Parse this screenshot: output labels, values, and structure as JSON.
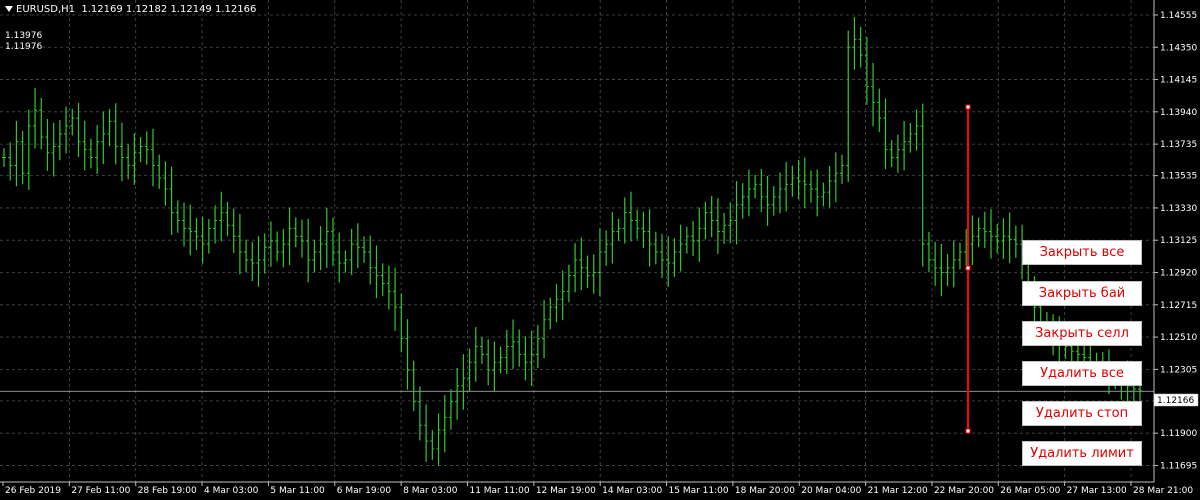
{
  "header": {
    "symbol_timeframe": "EURUSD,H1",
    "ohlc": "1.12169 1.12182 1.12149 1.12166"
  },
  "levels": [
    "1.13976",
    "1.11976"
  ],
  "buttons": [
    "Закрыть все",
    "Закрыть бай",
    "Закрыть селл",
    "Удалить все",
    "Удалить стоп",
    "Удалить лимит"
  ],
  "colors": {
    "background": "#000000",
    "grid": "#4d4d4d",
    "candles": "#32c832",
    "current_price_line": "#c0c0c0",
    "measure_line": "#ff0000",
    "button_text": "#e00000"
  },
  "chart_data": {
    "type": "line",
    "style": "hourly bars",
    "symbol": "EURUSD",
    "timeframe": "H1",
    "grid": true,
    "current_price": "1.12166",
    "ylim": [
      1.1159,
      1.1465
    ],
    "y_ticks": [
      "1.14555",
      "1.14350",
      "1.14145",
      "1.13940",
      "1.13735",
      "1.13535",
      "1.13330",
      "1.13125",
      "1.12920",
      "1.12715",
      "1.12510",
      "1.12305",
      "1.12105",
      "1.11900",
      "1.11695"
    ],
    "x_ticks": [
      "26 Feb 2019",
      "27 Feb 11:00",
      "28 Feb 19:00",
      "4 Mar 03:00",
      "5 Mar 11:00",
      "6 Mar 19:00",
      "8 Mar 03:00",
      "11 Mar 11:00",
      "12 Mar 19:00",
      "14 Mar 03:00",
      "15 Mar 11:00",
      "18 Mar 20:00",
      "20 Mar 04:00",
      "21 Mar 12:00",
      "22 Mar 20:00",
      "26 Mar 05:00",
      "27 Mar 13:00",
      "28 Mar 21:00"
    ],
    "series": [
      {
        "values": [
          1.1365,
          1.136,
          1.1375,
          1.1355,
          1.1385,
          1.1395,
          1.1378,
          1.1368,
          1.1372,
          1.138,
          1.1385,
          1.139,
          1.1375,
          1.137,
          1.1365,
          1.1375,
          1.138,
          1.1388,
          1.1372,
          1.1365,
          1.136,
          1.1368,
          1.1372,
          1.137,
          1.136,
          1.1352,
          1.1345,
          1.133,
          1.1325,
          1.132,
          1.1318,
          1.1315,
          1.131,
          1.132,
          1.1325,
          1.133,
          1.1322,
          1.1315,
          1.1305,
          1.13,
          1.1298,
          1.13,
          1.1308,
          1.1312,
          1.1305,
          1.131,
          1.132,
          1.1315,
          1.1312,
          1.13,
          1.1305,
          1.131,
          1.1318,
          1.1305,
          1.1298,
          1.13,
          1.131,
          1.1308,
          1.1305,
          1.1295,
          1.129,
          1.1285,
          1.128,
          1.127,
          1.125,
          1.123,
          1.121,
          1.1195,
          1.1185,
          1.118,
          1.1192,
          1.12,
          1.121,
          1.122,
          1.1225,
          1.1235,
          1.1245,
          1.124,
          1.123,
          1.1235,
          1.1238,
          1.1245,
          1.1248,
          1.124,
          1.1235,
          1.124,
          1.125,
          1.1262,
          1.127,
          1.1275,
          1.128,
          1.129,
          1.13,
          1.1295,
          1.129,
          1.1292,
          1.1305,
          1.131,
          1.1318,
          1.132,
          1.133,
          1.1325,
          1.132,
          1.1318,
          1.131,
          1.1305,
          1.13,
          1.1298,
          1.1305,
          1.131,
          1.1315,
          1.1312,
          1.132,
          1.133,
          1.1325,
          1.1318,
          1.1322,
          1.1325,
          1.1335,
          1.134,
          1.1345,
          1.1348,
          1.134,
          1.1335,
          1.134,
          1.1345,
          1.1348,
          1.1352,
          1.135,
          1.1348,
          1.1345,
          1.134,
          1.1343,
          1.135,
          1.1355,
          1.136,
          1.1435,
          1.144,
          1.143,
          1.141,
          1.14,
          1.139,
          1.137,
          1.1365,
          1.137,
          1.1375,
          1.138,
          1.1385,
          1.131,
          1.13,
          1.1295,
          1.1292,
          1.1295,
          1.13,
          1.1305,
          1.131,
          1.1315,
          1.132,
          1.1318,
          1.1315,
          1.1312,
          1.1315,
          1.1313,
          1.131,
          1.13,
          1.128,
          1.127,
          1.126,
          1.1255,
          1.125,
          1.1248,
          1.1245,
          1.1242,
          1.124,
          1.1238,
          1.1235,
          1.1232,
          1.123,
          1.1228,
          1.1225,
          1.1222,
          1.122,
          1.1218,
          1.1217
        ]
      }
    ]
  }
}
